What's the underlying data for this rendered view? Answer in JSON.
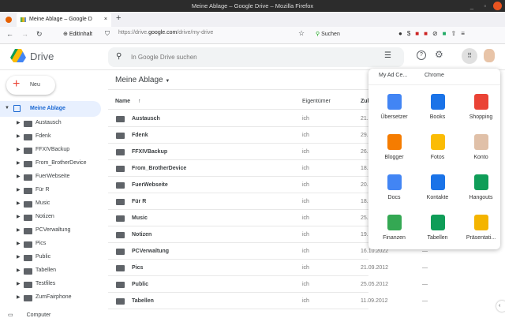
{
  "window": {
    "title": "Meine Ablage – Google Drive – Mozilla Firefox"
  },
  "browser": {
    "tab_title": "Meine Ablage – Google D",
    "new_tab": "+",
    "bookmark": "EditInhalt",
    "url_prefix": "https://drive.",
    "url_domain": "google.com",
    "url_path": "/drive/my-drive",
    "search_label": "Suchen"
  },
  "app": {
    "name": "Drive",
    "search_placeholder": "In Google Drive suchen",
    "new_button": "Neu"
  },
  "sidebar": {
    "my_drive": "Meine Ablage",
    "items": [
      "Austausch",
      "Fdenk",
      "FFXIVBackup",
      "From_BrotherDevice",
      "FuerWebseite",
      "Für R",
      "Music",
      "Notizen",
      "PCVerwaltung",
      "Pics",
      "Public",
      "Tabellen",
      "Testfiles",
      "ZumFairphone"
    ],
    "computers": "Computer"
  },
  "main": {
    "title": "Meine Ablage",
    "columns": {
      "name": "Name",
      "owner": "Eigentümer",
      "modified": "Zul"
    },
    "rows": [
      {
        "name": "Austausch",
        "owner": "ich",
        "date": "21.",
        "size": ""
      },
      {
        "name": "Fdenk",
        "owner": "ich",
        "date": "29.",
        "size": ""
      },
      {
        "name": "FFXIVBackup",
        "owner": "ich",
        "date": "26.",
        "size": ""
      },
      {
        "name": "From_BrotherDevice",
        "owner": "ich",
        "date": "18.",
        "size": ""
      },
      {
        "name": "FuerWebseite",
        "owner": "ich",
        "date": "20.",
        "size": ""
      },
      {
        "name": "Für R",
        "owner": "ich",
        "date": "18.",
        "size": ""
      },
      {
        "name": "Music",
        "owner": "ich",
        "date": "25.",
        "size": ""
      },
      {
        "name": "Notizen",
        "owner": "ich",
        "date": "19.",
        "size": ""
      },
      {
        "name": "PCVerwaltung",
        "owner": "ich",
        "date": "16.10.2022",
        "size": "—"
      },
      {
        "name": "Pics",
        "owner": "ich",
        "date": "21.09.2012",
        "size": "—"
      },
      {
        "name": "Public",
        "owner": "ich",
        "date": "25.05.2012",
        "size": "—"
      },
      {
        "name": "Tabellen",
        "owner": "ich",
        "date": "11.09.2012",
        "size": "—"
      }
    ]
  },
  "apps": {
    "top": [
      "My Ad Ce...",
      "Chrome"
    ],
    "grid": [
      {
        "label": "Übersetzer",
        "color": "#4285f4"
      },
      {
        "label": "Books",
        "color": "#1a73e8"
      },
      {
        "label": "Shopping",
        "color": "#ea4335"
      },
      {
        "label": "Blogger",
        "color": "#f57c00"
      },
      {
        "label": "Fotos",
        "color": "#fbbc04"
      },
      {
        "label": "Konto",
        "color": "#e0c0a8"
      },
      {
        "label": "Docs",
        "color": "#4285f4"
      },
      {
        "label": "Kontakte",
        "color": "#1a73e8"
      },
      {
        "label": "Hangouts",
        "color": "#0f9d58"
      },
      {
        "label": "Finanzen",
        "color": "#34a853"
      },
      {
        "label": "Tabellen",
        "color": "#0f9d58"
      },
      {
        "label": "Präsentati...",
        "color": "#f4b400"
      }
    ]
  }
}
